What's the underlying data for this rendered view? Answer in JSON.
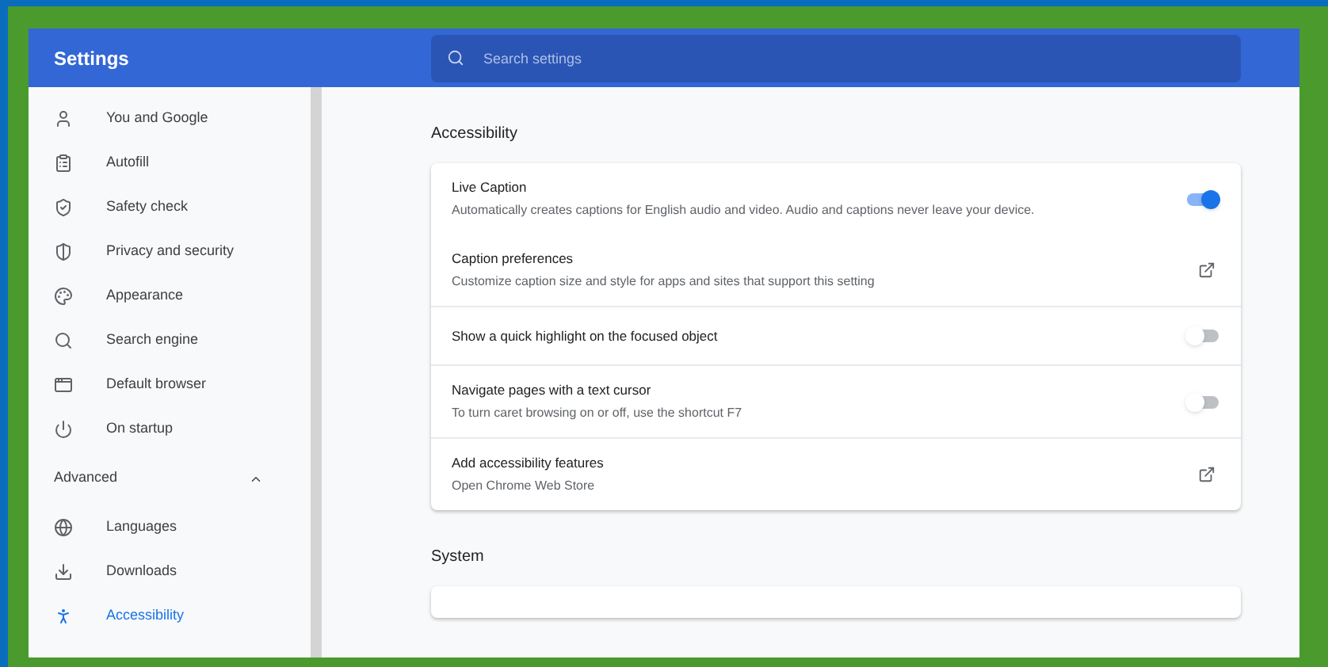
{
  "header": {
    "title": "Settings",
    "search": {
      "placeholder": "Search settings"
    }
  },
  "sidebar": {
    "items": [
      {
        "label": "You and Google",
        "selected": false
      },
      {
        "label": "Autofill",
        "selected": false
      },
      {
        "label": "Safety check",
        "selected": false
      },
      {
        "label": "Privacy and security",
        "selected": false
      },
      {
        "label": "Appearance",
        "selected": false
      },
      {
        "label": "Search engine",
        "selected": false
      },
      {
        "label": "Default browser",
        "selected": false
      },
      {
        "label": "On startup",
        "selected": false
      }
    ],
    "advanced": {
      "label": "Advanced",
      "expanded": true,
      "items": [
        {
          "label": "Languages",
          "selected": false
        },
        {
          "label": "Downloads",
          "selected": false
        },
        {
          "label": "Accessibility",
          "selected": true
        }
      ]
    }
  },
  "sections": [
    {
      "title": "Accessibility",
      "groups": [
        [
          {
            "kind": "toggle",
            "title": "Live Caption",
            "description": "Automatically creates captions for English audio and video. Audio and captions never leave your device.",
            "on": true
          },
          {
            "kind": "link",
            "title": "Caption preferences",
            "description": "Customize caption size and style for apps and sites that support this setting"
          }
        ],
        [
          {
            "kind": "toggle",
            "title": "Show a quick highlight on the focused object",
            "on": false
          }
        ],
        [
          {
            "kind": "toggle",
            "title": "Navigate pages with a text cursor",
            "description": "To turn caret browsing on or off, use the shortcut F7",
            "on": false
          }
        ],
        [
          {
            "kind": "link",
            "title": "Add accessibility features",
            "description": "Open Chrome Web Store"
          }
        ]
      ]
    },
    {
      "title": "System"
    }
  ]
}
